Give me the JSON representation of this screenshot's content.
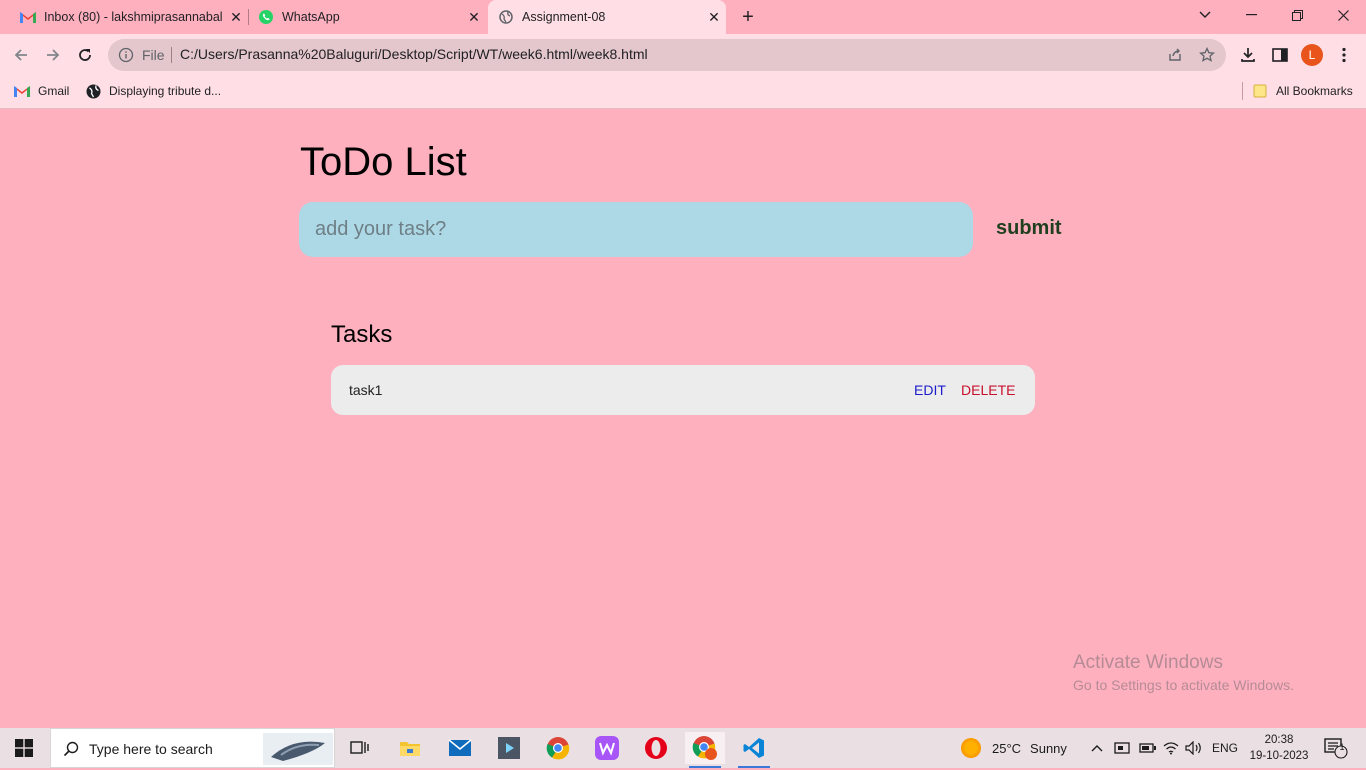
{
  "browser": {
    "tabs": [
      {
        "title": "Inbox (80) - lakshmiprasannabal",
        "icon": "gmail-icon",
        "active": false
      },
      {
        "title": "WhatsApp",
        "icon": "whatsapp-icon",
        "active": false
      },
      {
        "title": "Assignment-08",
        "icon": "globe-icon",
        "active": true
      }
    ],
    "address": {
      "scheme_label": "File",
      "url": "C:/Users/Prasanna%20Baluguri/Desktop/Script/WT/week6.html/week8.html"
    },
    "profile_initial": "L",
    "bookmarks": [
      {
        "label": "Gmail",
        "icon": "gmail-icon"
      },
      {
        "label": "Displaying tribute d...",
        "icon": "globe-icon"
      }
    ],
    "all_bookmarks_label": "All Bookmarks"
  },
  "page": {
    "title": "ToDo List",
    "input_placeholder": "add your task?",
    "submit_label": "submit",
    "tasks_heading": "Tasks",
    "tasks": [
      {
        "text": "task1",
        "edit_label": "EDIT",
        "delete_label": "DELETE"
      }
    ]
  },
  "watermark": {
    "line1": "Activate Windows",
    "line2": "Go to Settings to activate Windows."
  },
  "taskbar": {
    "search_placeholder": "Type here to search",
    "weather": {
      "temp": "25°C",
      "condition": "Sunny"
    },
    "language": "ENG",
    "time": "20:38",
    "date": "19-10-2023",
    "notification_count": "1"
  },
  "colors": {
    "page_bg": "#ffb0bf",
    "input_bg": "#add8e6",
    "task_bg": "#ececec",
    "edit": "#1c1ccc",
    "delete": "#c8102e",
    "submit": "#1f3f1f"
  }
}
